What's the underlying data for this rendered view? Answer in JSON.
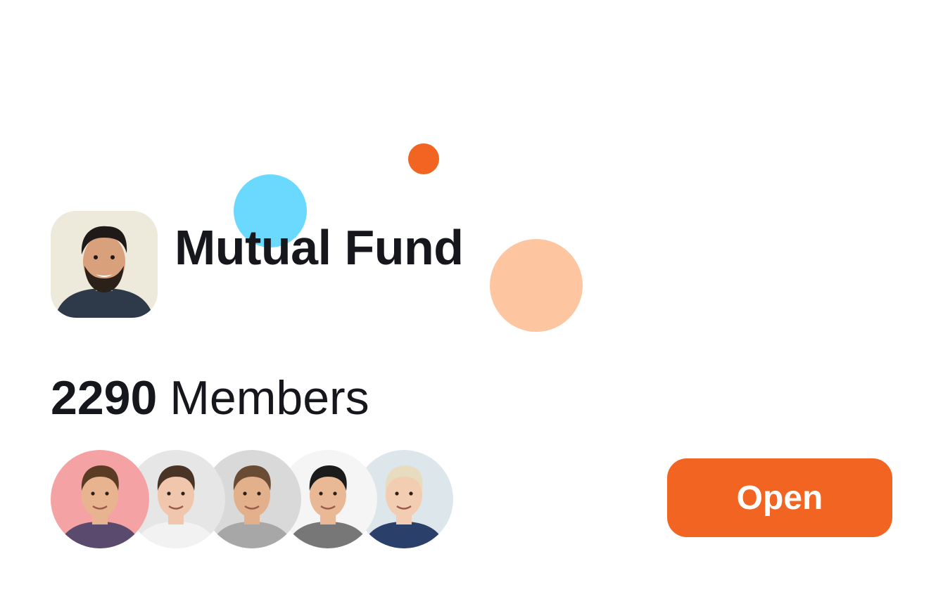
{
  "colors": {
    "accent": "#f26422",
    "bubble_blue": "#6bd9fe",
    "bubble_orange": "#f26422",
    "bubble_peach": "#fec6a0",
    "text_primary": "#16161d",
    "button_text": "#ffffff"
  },
  "group": {
    "title": "Mutual Fund",
    "avatar_icon": "person-avatar"
  },
  "members": {
    "count": "2290",
    "label": "Members",
    "avatars": [
      {
        "icon": "member-avatar-1",
        "bg": "#f4a2a4",
        "skin": "#e7b48f",
        "hair": "#5a3b24",
        "shirt": "#5a4a6e"
      },
      {
        "icon": "member-avatar-2",
        "bg": "#e6e6e6",
        "skin": "#f0c7ac",
        "hair": "#4a3426",
        "shirt": "#f2f2f2"
      },
      {
        "icon": "member-avatar-3",
        "bg": "#d9d9d9",
        "skin": "#e3b08c",
        "hair": "#6a4b33",
        "shirt": "#a7a7a7"
      },
      {
        "icon": "member-avatar-4",
        "bg": "#f5f5f5",
        "skin": "#e9b995",
        "hair": "#1b1b1b",
        "shirt": "#777777"
      },
      {
        "icon": "member-avatar-5",
        "bg": "#dde6ea",
        "skin": "#f3cdb2",
        "hair": "#e8dcc0",
        "shirt": "#2b3f6b"
      }
    ]
  },
  "actions": {
    "open_label": "Open"
  }
}
